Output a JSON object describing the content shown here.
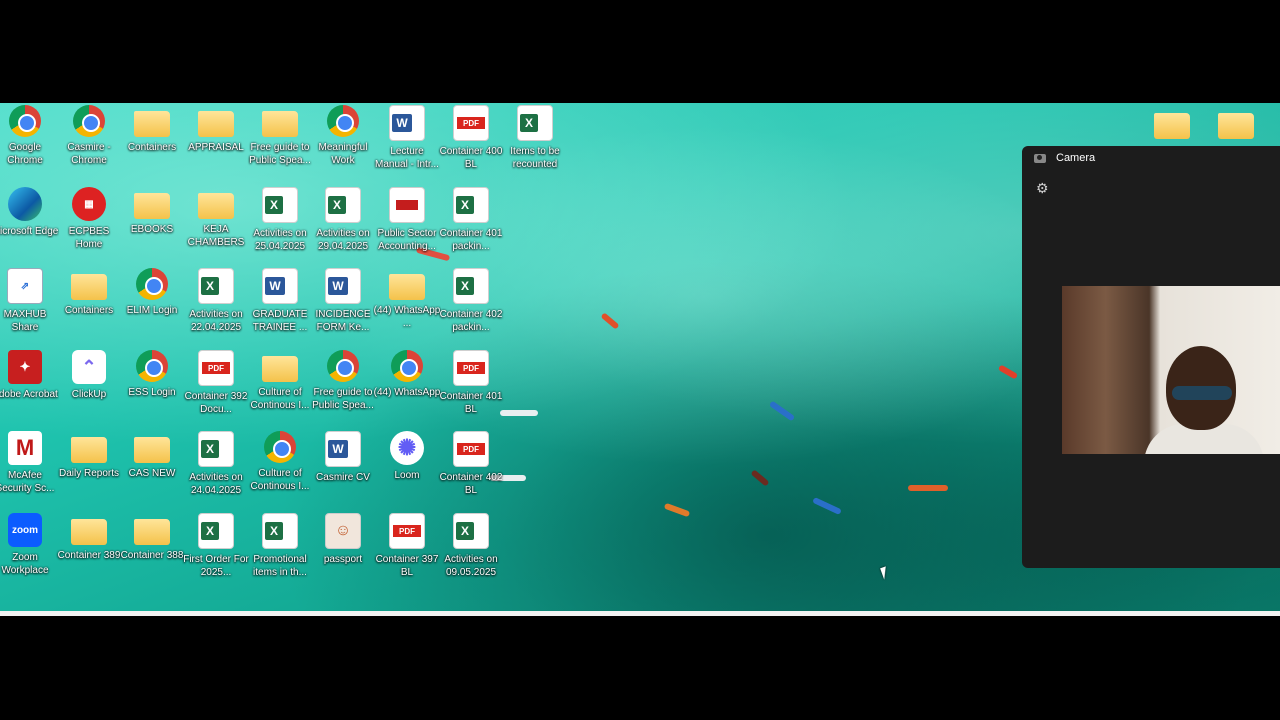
{
  "desktop_icons": [
    {
      "label": "Google Chrome",
      "type": "chrome",
      "col": 0,
      "row": 0
    },
    {
      "label": "Casmire - Chrome",
      "type": "chrome",
      "col": 1,
      "row": 0
    },
    {
      "label": "Containers",
      "type": "folder",
      "col": 2,
      "row": 0
    },
    {
      "label": "APPRAISAL",
      "type": "folder",
      "col": 3,
      "row": 0
    },
    {
      "label": "Free guide to Public Spea...",
      "type": "folder",
      "col": 4,
      "row": 0
    },
    {
      "label": "Meaningful Work",
      "type": "chrome",
      "col": 5,
      "row": 0
    },
    {
      "label": "Lecture Manual - Intr...",
      "type": "word",
      "col": 6,
      "row": 0
    },
    {
      "label": "Container 400 BL",
      "type": "pdf",
      "col": 7,
      "row": 0
    },
    {
      "label": "Items to be recounted",
      "type": "excel",
      "col": 8,
      "row": 0
    },
    {
      "label": "Microsoft Edge",
      "type": "edge",
      "col": 0,
      "row": 1
    },
    {
      "label": "ECPBES Home",
      "type": "ecpbes",
      "col": 1,
      "row": 1
    },
    {
      "label": "EBOOKS",
      "type": "folder",
      "col": 2,
      "row": 1
    },
    {
      "label": "KEJA CHAMBERS",
      "type": "folder",
      "col": 3,
      "row": 1
    },
    {
      "label": "Activities on 25.04.2025",
      "type": "excel",
      "col": 4,
      "row": 1
    },
    {
      "label": "Activities on 29.04.2025",
      "type": "excel",
      "col": 5,
      "row": 1
    },
    {
      "label": "Public Sector Accounting...",
      "type": "accounting",
      "col": 6,
      "row": 1
    },
    {
      "label": "Container 401 packin...",
      "type": "excel",
      "col": 7,
      "row": 1
    },
    {
      "label": "MAXHUB Share",
      "type": "maxhub",
      "col": 0,
      "row": 2
    },
    {
      "label": "Containers",
      "type": "folder",
      "col": 1,
      "row": 2
    },
    {
      "label": "ELIM Login",
      "type": "chrome",
      "col": 2,
      "row": 2
    },
    {
      "label": "Activities on 22.04.2025",
      "type": "excel",
      "col": 3,
      "row": 2
    },
    {
      "label": "GRADUATE TRAINEE ...",
      "type": "word",
      "col": 4,
      "row": 2
    },
    {
      "label": "INCIDENCE FORM Ke...",
      "type": "word",
      "col": 5,
      "row": 2
    },
    {
      "label": "(44) WhatsApp ...",
      "type": "folder",
      "col": 6,
      "row": 2
    },
    {
      "label": "Container 402 packin...",
      "type": "excel",
      "col": 7,
      "row": 2
    },
    {
      "label": "Adobe Acrobat",
      "type": "adobe",
      "col": 0,
      "row": 3
    },
    {
      "label": "ClickUp",
      "type": "clickup",
      "col": 1,
      "row": 3
    },
    {
      "label": "ESS Login",
      "type": "chrome",
      "col": 2,
      "row": 3
    },
    {
      "label": "Container 392 Docu...",
      "type": "pdf",
      "col": 3,
      "row": 3
    },
    {
      "label": "Culture of Continous I...",
      "type": "folder",
      "col": 4,
      "row": 3
    },
    {
      "label": "Free guide to Public Spea...",
      "type": "chrome",
      "col": 5,
      "row": 3
    },
    {
      "label": "(44) WhatsApp",
      "type": "chrome",
      "col": 6,
      "row": 3
    },
    {
      "label": "Container 401 BL",
      "type": "pdf",
      "col": 7,
      "row": 3
    },
    {
      "label": "McAfee Security Sc...",
      "type": "mcafee",
      "col": 0,
      "row": 4
    },
    {
      "label": "Daily Reports",
      "type": "folder",
      "col": 1,
      "row": 4
    },
    {
      "label": "CAS NEW",
      "type": "folder",
      "col": 2,
      "row": 4
    },
    {
      "label": "Activities on 24.04.2025",
      "type": "excel",
      "col": 3,
      "row": 4
    },
    {
      "label": "Culture of Continous I...",
      "type": "chrome",
      "col": 4,
      "row": 4
    },
    {
      "label": "Casmire CV",
      "type": "word",
      "col": 5,
      "row": 4
    },
    {
      "label": "Loom",
      "type": "loom",
      "col": 6,
      "row": 4
    },
    {
      "label": "Container 402 BL",
      "type": "pdf",
      "col": 7,
      "row": 4
    },
    {
      "label": "Zoom Workplace",
      "type": "zoom",
      "col": 0,
      "row": 5
    },
    {
      "label": "Container 389",
      "type": "folder",
      "col": 1,
      "row": 5
    },
    {
      "label": "Container 388",
      "type": "folder",
      "col": 2,
      "row": 5
    },
    {
      "label": "First Order For 2025...",
      "type": "excel",
      "col": 3,
      "row": 5
    },
    {
      "label": "Promotional items in th...",
      "type": "excel",
      "col": 4,
      "row": 5
    },
    {
      "label": "passport",
      "type": "passport",
      "col": 5,
      "row": 5
    },
    {
      "label": "Container 397 BL",
      "type": "pdf",
      "col": 6,
      "row": 5
    },
    {
      "label": "Activities on 09.05.2025",
      "type": "excel",
      "col": 7,
      "row": 5
    }
  ],
  "glyph_text": {
    "excel": "X",
    "word": "W",
    "pdf": "PDF",
    "zoom": "zoom",
    "adobe": "✦",
    "mcafee": "M",
    "maxhub": "⇗",
    "clickup": "⌃",
    "ecpbes": "▦",
    "loom": "✺",
    "passport": "☺",
    "edge": "",
    "chrome": "",
    "folder": "",
    "accounting": ""
  },
  "camera_panel": {
    "title": "Camera",
    "settings_icon": "gear-icon"
  },
  "colors": {
    "sea": "#1fc3ae",
    "panel": "#1c1c1c"
  }
}
